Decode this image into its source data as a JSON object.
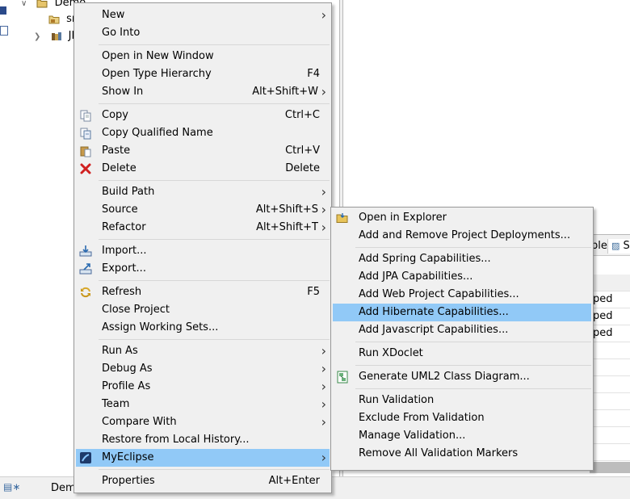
{
  "explorer": {
    "project_name": "Demo",
    "child_src": "sr",
    "child_jre": "JF"
  },
  "status_text": "Dem",
  "lower_panel": {
    "tab_table": "ble",
    "tab_s": "S",
    "rows": [
      "",
      "ped",
      "ped",
      "ped",
      "",
      "",
      "",
      "",
      "",
      "",
      ""
    ]
  },
  "context_menu": {
    "groups": [
      [
        {
          "label": "New",
          "shortcut": "",
          "submenu": true,
          "icon": ""
        },
        {
          "label": "Go Into",
          "shortcut": "",
          "submenu": false,
          "icon": ""
        }
      ],
      [
        {
          "label": "Open in New Window",
          "shortcut": "",
          "submenu": false,
          "icon": ""
        },
        {
          "label": "Open Type Hierarchy",
          "shortcut": "F4",
          "submenu": false,
          "icon": ""
        },
        {
          "label": "Show In",
          "shortcut": "Alt+Shift+W",
          "submenu": true,
          "icon": ""
        }
      ],
      [
        {
          "label": "Copy",
          "shortcut": "Ctrl+C",
          "submenu": false,
          "icon": "copy-icon"
        },
        {
          "label": "Copy Qualified Name",
          "shortcut": "",
          "submenu": false,
          "icon": "copy-qualified-name-icon"
        },
        {
          "label": "Paste",
          "shortcut": "Ctrl+V",
          "submenu": false,
          "icon": "paste-icon"
        },
        {
          "label": "Delete",
          "shortcut": "Delete",
          "submenu": false,
          "icon": "delete-icon"
        }
      ],
      [
        {
          "label": "Build Path",
          "shortcut": "",
          "submenu": true,
          "icon": ""
        },
        {
          "label": "Source",
          "shortcut": "Alt+Shift+S",
          "submenu": true,
          "icon": ""
        },
        {
          "label": "Refactor",
          "shortcut": "Alt+Shift+T",
          "submenu": true,
          "icon": ""
        }
      ],
      [
        {
          "label": "Import...",
          "shortcut": "",
          "submenu": false,
          "icon": "import-icon"
        },
        {
          "label": "Export...",
          "shortcut": "",
          "submenu": false,
          "icon": "export-icon"
        }
      ],
      [
        {
          "label": "Refresh",
          "shortcut": "F5",
          "submenu": false,
          "icon": "refresh-icon"
        },
        {
          "label": "Close Project",
          "shortcut": "",
          "submenu": false,
          "icon": ""
        },
        {
          "label": "Assign Working Sets...",
          "shortcut": "",
          "submenu": false,
          "icon": ""
        }
      ],
      [
        {
          "label": "Run As",
          "shortcut": "",
          "submenu": true,
          "icon": ""
        },
        {
          "label": "Debug As",
          "shortcut": "",
          "submenu": true,
          "icon": ""
        },
        {
          "label": "Profile As",
          "shortcut": "",
          "submenu": true,
          "icon": ""
        },
        {
          "label": "Team",
          "shortcut": "",
          "submenu": true,
          "icon": ""
        },
        {
          "label": "Compare With",
          "shortcut": "",
          "submenu": true,
          "icon": ""
        },
        {
          "label": "Restore from Local History...",
          "shortcut": "",
          "submenu": false,
          "icon": ""
        },
        {
          "label": "MyEclipse",
          "shortcut": "",
          "submenu": true,
          "icon": "myeclipse-icon",
          "highlighted": true
        }
      ],
      [
        {
          "label": "Properties",
          "shortcut": "Alt+Enter",
          "submenu": false,
          "icon": ""
        }
      ]
    ]
  },
  "myeclipse_submenu": {
    "groups": [
      [
        {
          "label": "Open in Explorer",
          "icon": "open-folder-icon"
        },
        {
          "label": "Add and Remove Project Deployments...",
          "icon": ""
        }
      ],
      [
        {
          "label": "Add Spring Capabilities...",
          "icon": ""
        },
        {
          "label": "Add JPA Capabilities...",
          "icon": ""
        },
        {
          "label": "Add Web Project Capabilities...",
          "icon": ""
        },
        {
          "label": "Add Hibernate Capabilities...",
          "icon": "",
          "highlighted": true
        },
        {
          "label": "Add Javascript Capabilities...",
          "icon": ""
        }
      ],
      [
        {
          "label": "Run XDoclet",
          "icon": ""
        }
      ],
      [
        {
          "label": "Generate UML2 Class Diagram...",
          "icon": "uml-diagram-icon"
        }
      ],
      [
        {
          "label": "Run Validation",
          "icon": ""
        },
        {
          "label": "Exclude From Validation",
          "icon": ""
        },
        {
          "label": "Manage Validation...",
          "icon": ""
        },
        {
          "label": "Remove All Validation Markers",
          "icon": ""
        }
      ]
    ]
  },
  "colors": {
    "highlight": "#91c9f7",
    "menu_bg": "#f0f0f0",
    "separator": "#d7d7d7"
  }
}
